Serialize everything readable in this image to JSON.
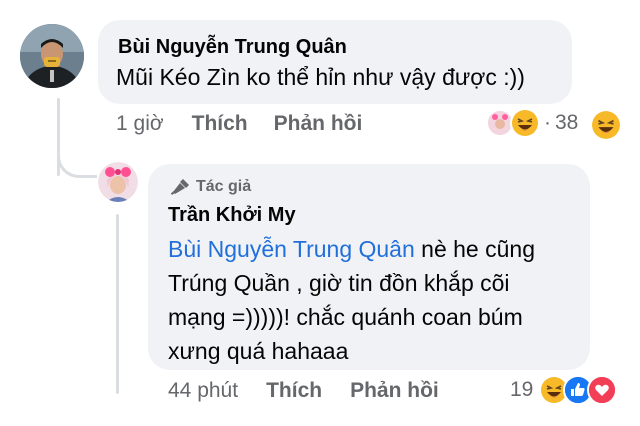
{
  "comment": {
    "author": "Bùi Nguyễn Trung Quân",
    "text": "Mũi Kéo Zìn ko thể hỉn như vậy được :))",
    "time": "1 giờ",
    "like_label": "Thích",
    "reply_label": "Phản hồi",
    "reaction_separator": "·",
    "reaction_count": "38",
    "reaction_icons": [
      "avatar-icon",
      "laughing-emoji-icon"
    ],
    "trailing_icon": "laughing-emoji-icon"
  },
  "reply": {
    "badge_label": "Tác giả",
    "badge_icon": "microphone-icon",
    "author": "Trần Khởi My",
    "mention": "Bùi Nguyễn Trung Quân",
    "line1_rest": " nè he cũng",
    "line2": "Trúng Quần , giờ tin đồn khắp cõi",
    "line3": "mạng =)))))! chắc quánh coan búm",
    "line4": "xưng quá hahaaa",
    "time": "44 phút",
    "like_label": "Thích",
    "reply_label": "Phản hồi",
    "reaction_count": "19",
    "reaction_icons": [
      "laughing-emoji-icon",
      "like-icon",
      "love-icon"
    ]
  },
  "colors": {
    "bubble": "#f0f2f5",
    "mention": "#216fdb",
    "meta": "#65676b",
    "like_blue": "#1877f2",
    "love_red": "#f33e58",
    "haha_yellow": "#f7b928"
  }
}
